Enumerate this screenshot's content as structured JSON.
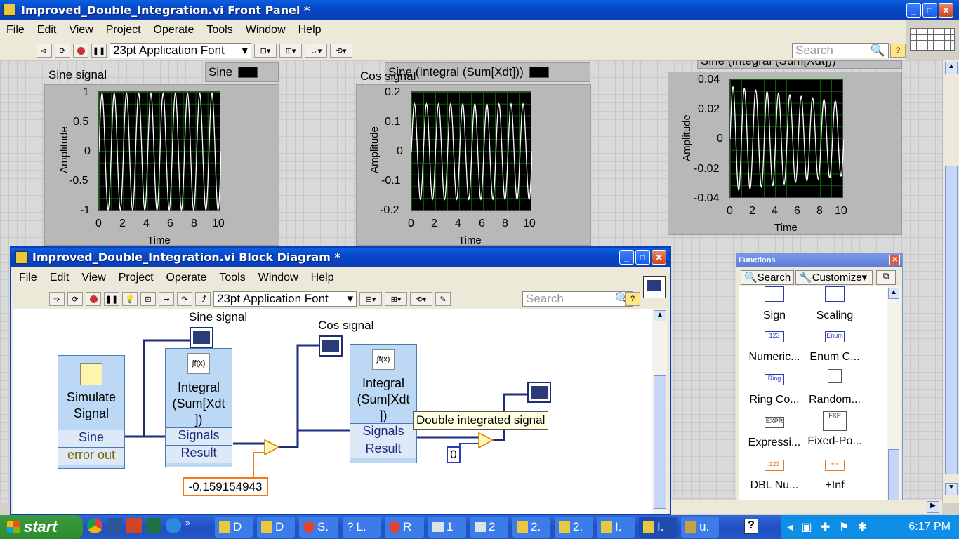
{
  "front_panel": {
    "title": "Improved_Double_Integration.vi Front Panel *",
    "menus": [
      "File",
      "Edit",
      "View",
      "Project",
      "Operate",
      "Tools",
      "Window",
      "Help"
    ],
    "font_selector": "23pt Application Font",
    "search_placeholder": "Search",
    "graphs": [
      {
        "label": "Sine signal",
        "legend": "Sine",
        "ylabel": "Amplitude",
        "xlabel": "Time",
        "yticks": [
          "1",
          "0.5",
          "0",
          "-0.5",
          "-1"
        ],
        "xticks": [
          "0",
          "2",
          "4",
          "6",
          "8",
          "10"
        ]
      },
      {
        "label": "Cos signal",
        "legend": "Sine (Integral (Sum[Xdt]))",
        "ylabel": "Amplitude",
        "xlabel": "Time",
        "yticks": [
          "0.2",
          "0.1",
          "0",
          "-0.1",
          "-0.2"
        ],
        "xticks": [
          "0",
          "2",
          "4",
          "6",
          "8",
          "10"
        ]
      },
      {
        "label": "",
        "legend": "Sine (Integral (Sum[Xdt]))",
        "ylabel": "Amplitude",
        "xlabel": "Time",
        "yticks": [
          "0.04",
          "0.02",
          "0",
          "-0.02",
          "-0.04"
        ],
        "xticks": [
          "0",
          "2",
          "4",
          "6",
          "8",
          "10"
        ]
      }
    ]
  },
  "block_diagram": {
    "title": "Improved_Double_Integration.vi Block Diagram *",
    "menus": [
      "File",
      "Edit",
      "View",
      "Project",
      "Operate",
      "Tools",
      "Window",
      "Help"
    ],
    "font_selector": "23pt Application Font",
    "search_placeholder": "Search",
    "labels": {
      "sine_signal": "Sine signal",
      "cos_signal": "Cos signal"
    },
    "simulate": {
      "title": "Simulate Signal",
      "out1": "Sine",
      "out2": "error out"
    },
    "integral1": {
      "title": "Integral (Sum[Xdt ])",
      "in": "Signals",
      "out": "Result"
    },
    "integral2": {
      "title": "Integral (Sum[Xdt ])",
      "in": "Signals",
      "out": "Result"
    },
    "constant_neg": "-0.159154943",
    "constant_zero": "0",
    "tooltip": "Double integrated signal"
  },
  "functions_palette": {
    "title": "Functions",
    "search": "Search",
    "customize": "Customize",
    "items": [
      "Sign",
      "Scaling",
      "Numeric...",
      "Enum C...",
      "Ring Co...",
      "Random...",
      "Expressi...",
      "Fixed-Po...",
      "DBL Nu...",
      "+Inf"
    ],
    "icons": [
      "sign-icon",
      "scaling-icon",
      "numeric-constant-icon",
      "enum-constant-icon",
      "ring-constant-icon",
      "random-number-icon",
      "expression-node-icon",
      "fixed-point-icon",
      "dbl-numeric-constant-icon",
      "positive-infinity-icon"
    ]
  },
  "taskbar": {
    "start": "start",
    "tasks": [
      "D",
      "D",
      "S.",
      "L.",
      "R",
      "1",
      "2",
      "2.",
      "2.",
      "I.",
      "I.",
      "u."
    ],
    "clock": "6:17 PM"
  },
  "colors": {
    "xp_blue": "#0a5fe0",
    "bd_node": "#bcd8f4",
    "wire_blue": "#1c2e7a",
    "wire_orange": "#f07818"
  }
}
